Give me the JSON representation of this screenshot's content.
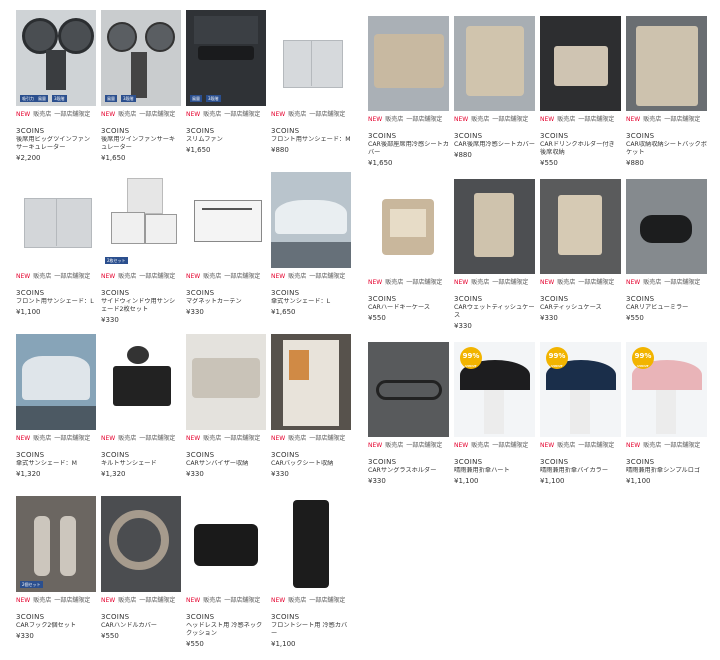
{
  "tags": {
    "new": "NEW",
    "store": "販売店",
    "limited": "一部店舗限定"
  },
  "left_products": [
    {
      "brand": "3COINS",
      "name": "後席用ビッグツインファンサーキュレーター",
      "price": "¥2,200",
      "img": "fan-black",
      "has_new": true,
      "badges": [
        "吸引力",
        "風量",
        "3段階"
      ]
    },
    {
      "brand": "3COINS",
      "name": "後席用ツインファンサーキュレーター",
      "price": "¥1,650",
      "img": "fan-black-small",
      "has_new": true,
      "badges": [
        "風量",
        "3段階"
      ]
    },
    {
      "brand": "3COINS",
      "name": "スリムファン",
      "price": "¥1,650",
      "img": "slim-fan",
      "has_new": true,
      "badges": [
        "風量",
        "3段階"
      ]
    },
    {
      "brand": "3COINS",
      "name": "フロント用サンシェード：M",
      "price": "¥880",
      "img": "sunshade-silver",
      "has_new": true,
      "badges": []
    },
    {
      "brand": "3COINS",
      "name": "フロント用サンシェード：L",
      "price": "¥1,100",
      "img": "sunshade-silver-l",
      "has_new": true,
      "badges": []
    },
    {
      "brand": "3COINS",
      "name": "サイドウィンドウ用サンシェード2枚セット",
      "price": "¥330",
      "img": "side-shade",
      "has_new": true,
      "badges": [
        "2枚セット"
      ]
    },
    {
      "brand": "3COINS",
      "name": "マグネットカーテン",
      "price": "¥330",
      "img": "magnet-curtain",
      "has_new": true,
      "badges": []
    },
    {
      "brand": "3COINS",
      "name": "傘式サンシェード：L",
      "price": "¥1,650",
      "img": "umbrella-shade-car",
      "has_new": true,
      "badges": []
    },
    {
      "brand": "3COINS",
      "name": "傘式サンシェード：M",
      "price": "¥1,320",
      "img": "umbrella-shade-window",
      "has_new": true,
      "badges": []
    },
    {
      "brand": "3COINS",
      "name": "キルトサンシェード",
      "price": "¥1,320",
      "img": "quilt-shade",
      "has_new": true,
      "badges": []
    },
    {
      "brand": "3COINS",
      "name": "CARサンバイザー収納",
      "price": "¥330",
      "img": "visor-storage",
      "has_new": true,
      "badges": []
    },
    {
      "brand": "3COINS",
      "name": "CARバックシート収納",
      "price": "¥330",
      "img": "back-seat-storage",
      "has_new": true,
      "badges": []
    },
    {
      "brand": "3COINS",
      "name": "CARフック2個セット",
      "price": "¥330",
      "img": "car-hook",
      "has_new": true,
      "badges": [
        "2個セット"
      ]
    },
    {
      "brand": "3COINS",
      "name": "CARハンドルカバー",
      "price": "¥550",
      "img": "handle-cover",
      "has_new": true,
      "badges": []
    },
    {
      "brand": "3COINS",
      "name": "ヘッドレスト用 冷感ネッククッション",
      "price": "¥550",
      "img": "neck-cushion",
      "has_new": true,
      "badges": []
    },
    {
      "brand": "3COINS",
      "name": "フロントシート用 冷感カバー",
      "price": "¥1,100",
      "img": "seat-cover-black",
      "has_new": true,
      "badges": []
    }
  ],
  "right_products": [
    {
      "brand": "3COINS",
      "name": "CAR後部座席用冷感シートカバー",
      "price": "¥1,650",
      "img": "rear-seat-cover",
      "has_new": true
    },
    {
      "brand": "3COINS",
      "name": "CAR後席用冷感シートカバー",
      "price": "¥880",
      "img": "rear-seat-cover-2",
      "has_new": true
    },
    {
      "brand": "3COINS",
      "name": "CARドリンクホルダー付き 後席収納",
      "price": "¥550",
      "img": "drink-holder",
      "has_new": true
    },
    {
      "brand": "3COINS",
      "name": "CAR収納収納シートバックポケット",
      "price": "¥880",
      "img": "seatback-pocket",
      "has_new": true
    },
    {
      "brand": "3COINS",
      "name": "CARハードキーケース",
      "price": "¥550",
      "img": "key-case",
      "has_new": true
    },
    {
      "brand": "3COINS",
      "name": "CARウェットティッシュケース",
      "price": "¥330",
      "img": "wet-tissue",
      "has_new": true
    },
    {
      "brand": "3COINS",
      "name": "CARティッシュケース",
      "price": "¥330",
      "img": "tissue-case",
      "has_new": true
    },
    {
      "brand": "3COINS",
      "name": "CARリアビューミラー",
      "price": "¥550",
      "img": "rear-mirror",
      "has_new": true
    },
    {
      "brand": "3COINS",
      "name": "CARサングラスホルダー",
      "price": "¥330",
      "img": "sunglass-holder",
      "has_new": true
    },
    {
      "brand": "3COINS",
      "name": "晴雨兼用折傘ハート",
      "price": "¥1,100",
      "img": "umbrella-heart",
      "has_new": true,
      "badge99": true
    },
    {
      "brand": "3COINS",
      "name": "晴雨兼用折傘バイカラー",
      "price": "¥1,100",
      "img": "umbrella-bicolor",
      "has_new": true,
      "badge99": true
    },
    {
      "brand": "3COINS",
      "name": "晴雨兼用折傘シンプルロゴ",
      "price": "¥1,100",
      "img": "umbrella-simple",
      "has_new": true,
      "badge99": true
    }
  ],
  "badge99": {
    "main": "99%",
    "sub": "UVCUT"
  }
}
